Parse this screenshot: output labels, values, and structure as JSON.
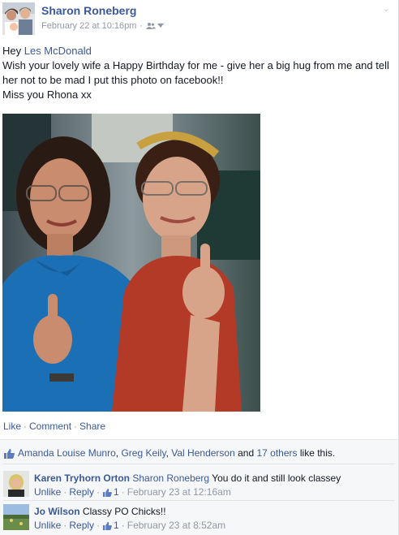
{
  "post": {
    "author": "Sharon Roneberg",
    "timestamp": "February 22 at 10:16pm",
    "separator": "·",
    "audience_icon": "friends-icon",
    "message": {
      "greeting": "Hey ",
      "mention": "Les McDonald",
      "line2": "Wish your lovely wife a Happy Birthday for me - give her a big hug from me and tell her not to be mad I put this photo on facebook!!",
      "line3": "Miss you Rhona xx"
    },
    "actions": {
      "like": "Like",
      "comment": "Comment",
      "share": "Share",
      "dot": "·"
    },
    "likes": {
      "icon": "thumbs-up-icon",
      "names": [
        "Amanda Louise Munro",
        "Greg Keily",
        "Val Henderson"
      ],
      "comma": ",",
      "and": "and",
      "others": "17 others",
      "suffix": "like this."
    },
    "comments": [
      {
        "author": "Karen Tryhorn Orton",
        "tag": "Sharon Roneberg",
        "text": "You do it and still look classey",
        "unlike": "Unlike",
        "reply": "Reply",
        "like_count": "1",
        "time": "February 23 at 12:16am"
      },
      {
        "author": "Jo Wilson",
        "tag": "",
        "text": "Classy PO Chicks!!",
        "unlike": "Unlike",
        "reply": "Reply",
        "like_count": "1",
        "time": "February 23 at 8:52am"
      }
    ]
  },
  "colors": {
    "link": "#3b5998",
    "meta": "#9197a3",
    "text": "#141823",
    "ufi_bg": "#f6f7f9"
  }
}
